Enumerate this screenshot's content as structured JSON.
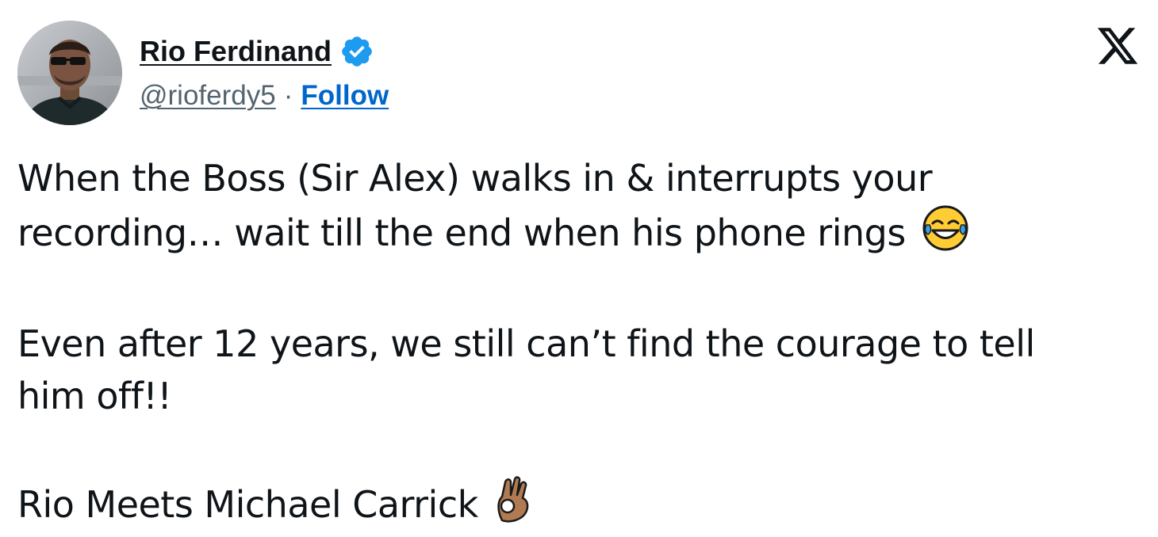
{
  "author": {
    "display_name": "Rio Ferdinand",
    "handle": "@rioferdy5",
    "separator": "·",
    "follow_label": "Follow",
    "verified": true
  },
  "platform_logo": "x-logo-icon",
  "colors": {
    "text": "#0f1419",
    "secondary": "#536471",
    "link": "#0066cc",
    "verified_badge": "#1d9bf0"
  },
  "tweet": {
    "line1": "When the Boss (Sir Alex) walks in & interrupts your",
    "line2": "recording… wait till the end when his phone rings",
    "line2_emoji": "face-with-tears-of-joy-icon",
    "line3": "Even after 12 years, we still can’t find the courage to tell",
    "line4": "him off!!",
    "line5": "Rio Meets Michael Carrick",
    "line5_emoji": "ok-hand-icon"
  }
}
